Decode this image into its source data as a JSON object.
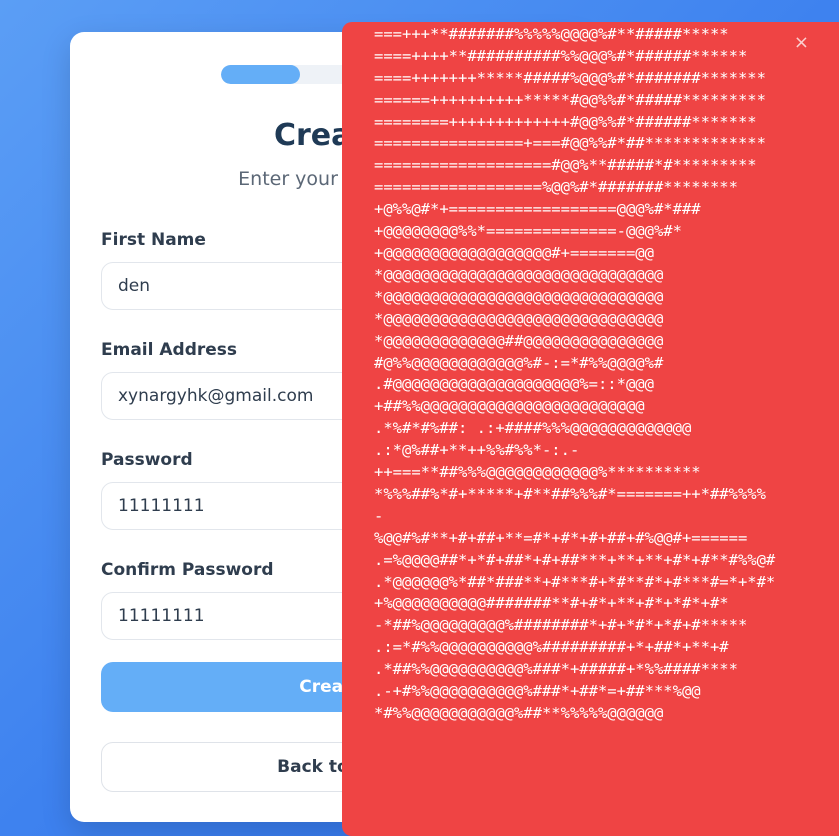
{
  "signup": {
    "title": "Create",
    "subtitle": "Enter your email ar",
    "progress_fraction": 0.36,
    "first_name": {
      "label": "First Name",
      "value": "den"
    },
    "email": {
      "label": "Email Address",
      "value": "xynargyhk@gmail.com"
    },
    "password": {
      "label": "Password",
      "value": "11111111"
    },
    "confirm_password": {
      "label": "Confirm Password",
      "value": "11111111"
    },
    "create_button": "Create",
    "back_button": "Back to Sig"
  },
  "overlay": {
    "close_label": "×",
    "ascii_lines": [
      "+++#########%%%%%%%%@@@@%#*****",
      "===+++**#######%%%%%@@@@%#**#####*****",
      "====++++**##########%%@@@%#*######******",
      "====+++++++*****#####%@@@%#*#######*******",
      "======++++++++++*****#@@%%#*#####*********",
      "========+++++++++++++#@@%%#*######*******",
      "================+===#@@%%#*##*************",
      "===================#@@%**#####*#*********",
      "==================%@@%#*#######********",
      "+@%%@#*+==================@@@%#*###",
      "+@@@@@@@@%%*==============-@@@%#*",
      "+@@@@@@@@@@@@@@@@@@#+=======@@",
      "*@@@@@@@@@@@@@@@@@@@@@@@@@@@@@@",
      "*@@@@@@@@@@@@@@@@@@@@@@@@@@@@@@",
      "*@@@@@@@@@@@@@@@@@@@@@@@@@@@@@@",
      "*@@@@@@@@@@@@@##@@@@@@@@@@@@@@@",
      "#@%%@@@@@@@@@@@@%#-:=*#%%@@@@%#",
      ".#@@@@@@@@@@@@@@@@@@@@%=::*@@@",
      "+##%%@@@@@@@@@@@@@@@@@@@@@@@@",
      ".*%#*#%##: .:+####%%%@@@@@@@@@@@@@",
      ".:*@%##+**++%%#%%*-:.-",
      "++===**##%%%@@@@@@@@@@@@%**********",
      "*%%%##%*#+*****+#**##%%%#*=======++*##%%%%",
      "-",
      "%@@#%#**+#+##+**=#*+#*+#+##+#%@@#+======",
      ".=%@@@@##*+*#+##*+#+##***+**+**+#*+#**#%%@#",
      ".*@@@@@@%*##*###**+#***#+*#**#*+#***#=*+*#*",
      "+%@@@@@@@@@@#######**#+#*+**+#*+*#*+#*",
      "-*##%@@@@@@@@@%########*+#+*#*+*#+#*****",
      ".:=*#%%@@@@@@@@@@%#########+*+##*+**+#",
      ".*##%%@@@@@@@@@@%###*+#####+*%%####****",
      ".-+#%%@@@@@@@@@@%###*+##*=+##***%@@",
      "*#%%@@@@@@@@@@@%##**%%%%%@@@@@@"
    ]
  }
}
